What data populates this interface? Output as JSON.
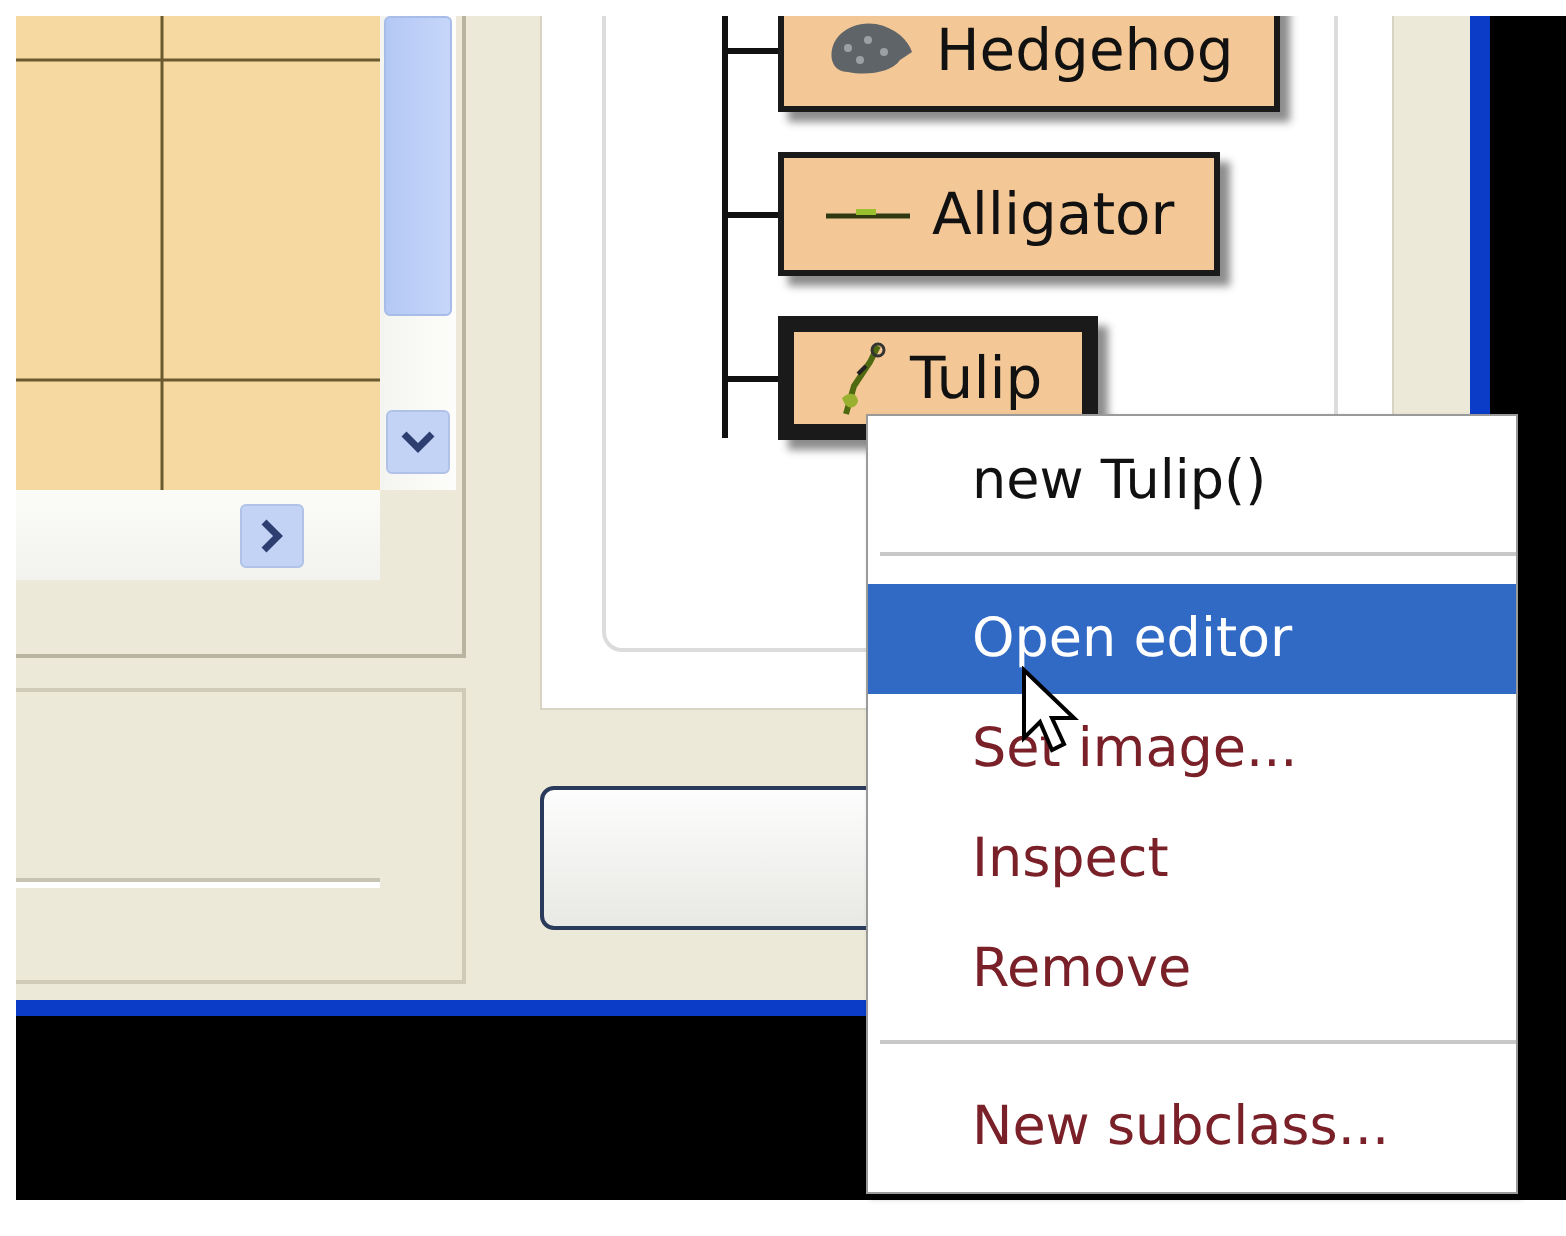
{
  "class_tree": {
    "classes": [
      {
        "label": "Hedgehog",
        "selected": false
      },
      {
        "label": "Alligator",
        "selected": false
      },
      {
        "label": "Tulip",
        "selected": true
      }
    ]
  },
  "context_menu": {
    "groups": [
      {
        "items": [
          {
            "label": "new Tulip()",
            "kind": "constructor",
            "selected": false
          }
        ]
      },
      {
        "items": [
          {
            "label": "Open editor",
            "kind": "command",
            "selected": true
          },
          {
            "label": "Set image...",
            "kind": "command",
            "selected": false
          },
          {
            "label": "Inspect",
            "kind": "command",
            "selected": false
          },
          {
            "label": "Remove",
            "kind": "command",
            "selected": false
          }
        ]
      },
      {
        "items": [
          {
            "label": "New subclass...",
            "kind": "command",
            "selected": false
          }
        ]
      }
    ]
  }
}
